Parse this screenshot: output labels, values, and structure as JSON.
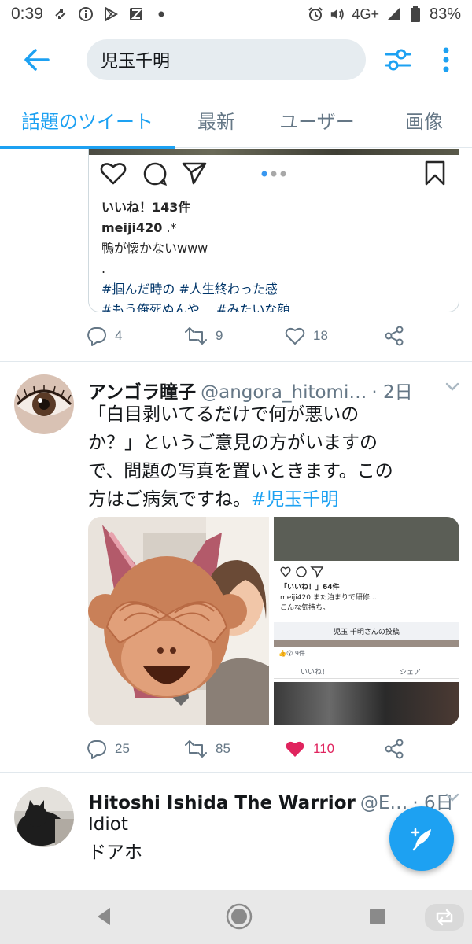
{
  "status_bar": {
    "time": "0:39",
    "network": "4G+",
    "battery": "83%"
  },
  "search": {
    "query": "児玉千明"
  },
  "tabs": [
    {
      "label": "話題のツイート",
      "active": true
    },
    {
      "label": "最新",
      "active": false
    },
    {
      "label": "ユーザー",
      "active": false
    },
    {
      "label": "画像",
      "active": false
    }
  ],
  "tweet1": {
    "instagram_card": {
      "likes": "いいね！143件",
      "username": "meiji420",
      "username_suffix": ".*",
      "caption": "鴨が懐かないwww",
      "dot": ".",
      "tags_line1": "#掴んだ時の #人生終わった感",
      "tags_line2": "#もう俺死ぬんや… #みたいな顔"
    },
    "replies": "4",
    "retweets": "9",
    "likes": "18"
  },
  "tweet2": {
    "name": "アンゴラ瞳子",
    "handle": "@angora_hitomi…",
    "time": "· 2日",
    "text_line1": "「白目剥いてるだけで何が悪いの",
    "text_line2": "か？」というご意見の方がいますの",
    "text_line3": "で、問題の写真を置いときます。この",
    "text_line4_prefix": "方はご病気ですね。",
    "hashtag": "#児玉千明",
    "media_right": {
      "likes": "「いいね！」64件",
      "caption1": "meiji420 また泊まりで研修…",
      "caption2": "こんな気持ち。",
      "header": "児玉 千明さんの投稿",
      "reactions": "9件",
      "like_btn": "いいね！",
      "share_btn": "シェア"
    },
    "replies": "25",
    "retweets": "85",
    "likes": "110",
    "like_color": "#e0245e"
  },
  "tweet3": {
    "name": "Hitoshi Ishida The Warrior",
    "handle": "@E…",
    "time": "· 6日",
    "text_line1": "Idiot",
    "text_line2": "ドアホ"
  },
  "colors": {
    "accent": "#1da1f2",
    "muted": "#657786"
  }
}
